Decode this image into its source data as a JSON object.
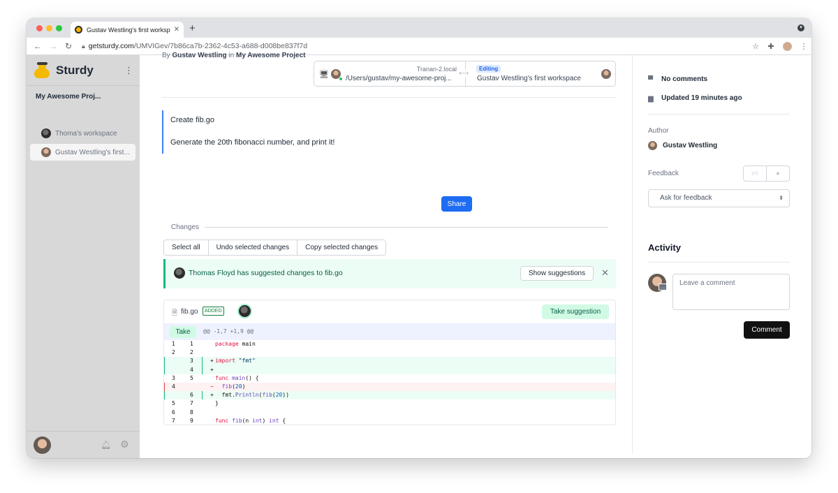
{
  "browser": {
    "tab_title": "Gustav Westling's first worksp",
    "tab_close": "✕",
    "new_tab": "+",
    "url_host": "getsturdy.com",
    "url_path": "/UMVIGev/7b86ca7b-2362-4c53-a688-d008be837f7d"
  },
  "sidebar": {
    "brand": "Sturdy",
    "project": "My Awesome Proj...",
    "workspaces": [
      {
        "label": "Thoma's workspace",
        "active": false
      },
      {
        "label": "Gustav Westling's first...",
        "active": true
      }
    ]
  },
  "header": {
    "by": "By",
    "author": "Gustav Westling",
    "in": "in",
    "project": "My Awesome Project"
  },
  "connection": {
    "host": "Tranan-2.local",
    "path": "/Users/gustav/my-awesome-proj...",
    "status_badge": "Editing",
    "workspace": "Gustav Westling's first workspace"
  },
  "description": {
    "title": "Create fib.go",
    "body": "Generate the 20th fibonacci number, and print it!"
  },
  "share_label": "Share",
  "changes": {
    "label": "Changes",
    "buttons": [
      "Select all",
      "Undo selected changes",
      "Copy selected changes"
    ],
    "suggestion": {
      "text": "Thomas Floyd has suggested changes to fib.go",
      "show_label": "Show suggestions",
      "close": "✕"
    },
    "file": {
      "name": "fib.go",
      "badge": "ADDED",
      "take_suggestion": "Take suggestion",
      "take": "Take",
      "hunk": "@@ -1,7 +1,9 @@",
      "lines": [
        {
          "type": "ctx",
          "old": "1",
          "new": "1",
          "sign": "",
          "code": "package main"
        },
        {
          "type": "ctx",
          "old": "2",
          "new": "2",
          "sign": "",
          "code": ""
        },
        {
          "type": "add",
          "old": "",
          "new": "3",
          "sign": "+",
          "code": "import \"fmt\""
        },
        {
          "type": "add",
          "old": "",
          "new": "4",
          "sign": "+",
          "code": ""
        },
        {
          "type": "ctx",
          "old": "3",
          "new": "5",
          "sign": "",
          "code": "func main() {"
        },
        {
          "type": "del",
          "old": "4",
          "new": "",
          "sign": "−",
          "code": "  fib(20)"
        },
        {
          "type": "add",
          "old": "",
          "new": "6",
          "sign": "+",
          "code": "  fmt.Println(fib(20))"
        },
        {
          "type": "ctx",
          "old": "5",
          "new": "7",
          "sign": "",
          "code": "}"
        },
        {
          "type": "ctx",
          "old": "6",
          "new": "8",
          "sign": "",
          "code": ""
        },
        {
          "type": "ctx",
          "old": "7",
          "new": "9",
          "sign": "",
          "code": "func fib(n int) int {"
        }
      ]
    }
  },
  "right_panel": {
    "comments": "No comments",
    "updated": "Updated 19 minutes ago",
    "author_label": "Author",
    "author_name": "Gustav Westling",
    "feedback_label": "Feedback",
    "feedback_select": "Ask for feedback",
    "activity_title": "Activity",
    "comment_placeholder": "Leave a comment",
    "comment_button": "Comment"
  }
}
